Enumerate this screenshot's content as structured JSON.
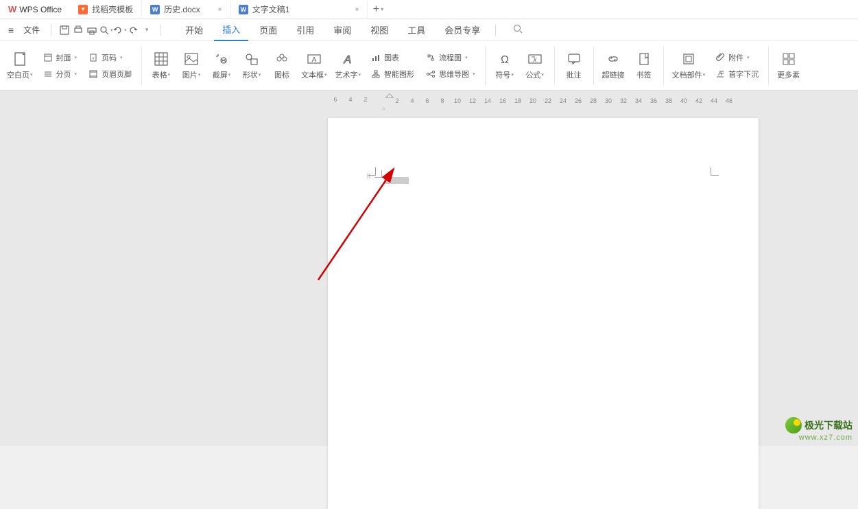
{
  "app": {
    "name": "WPS Office"
  },
  "tabs": [
    {
      "label": "找稻壳模板",
      "type": "fire"
    },
    {
      "label": "历史.docx",
      "type": "doc",
      "dot": true
    },
    {
      "label": "文字文稿1",
      "type": "doc",
      "dot": true
    }
  ],
  "qa": {
    "file": "文件"
  },
  "menu": {
    "items": [
      "开始",
      "插入",
      "页面",
      "引用",
      "审阅",
      "视图",
      "工具",
      "会员专享"
    ],
    "active": 1
  },
  "ribbon": {
    "blank_page": "空白页",
    "cover": "封面",
    "section": "分页",
    "page_number": "页码",
    "header_footer": "页眉页脚",
    "table": "表格",
    "picture": "图片",
    "screenshot": "截屏",
    "shapes": "形状",
    "icon": "图标",
    "textbox": "文本框",
    "wordart": "艺术字",
    "chart": "图表",
    "smart_graphic": "智能图形",
    "flowchart": "流程图",
    "mindmap": "思维导图",
    "symbol": "符号",
    "equation": "公式",
    "comment": "批注",
    "hyperlink": "超链接",
    "bookmark": "书签",
    "doc_parts": "文档部件",
    "attachment": "附件",
    "drop_cap": "首字下沉",
    "more": "更多素"
  },
  "ruler": {
    "left": [
      "6",
      "4",
      "2"
    ],
    "right": [
      "2",
      "4",
      "6",
      "8",
      "10",
      "12",
      "14",
      "16",
      "18",
      "20",
      "22",
      "24",
      "26",
      "28",
      "30",
      "32",
      "34",
      "36",
      "38",
      "40",
      "42",
      "44",
      "46"
    ]
  },
  "watermark": {
    "title": "极光下载站",
    "url": "www.xz7.com"
  }
}
